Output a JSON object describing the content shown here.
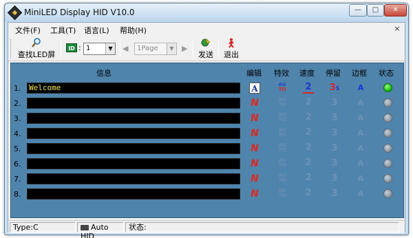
{
  "window": {
    "title": "MiniLED Display HID V10.0"
  },
  "window_controls": {
    "minimize": "—",
    "maximize": "□",
    "close": "✕"
  },
  "menu": {
    "items": [
      "文件(F)",
      "工具(T)",
      "语言(L)",
      "帮助(H)"
    ],
    "close_glyph": "×"
  },
  "toolbar": {
    "find_screen_label": "查找LED屏",
    "id_label": "ID",
    "id_colon": ":",
    "id_value": "1",
    "prev_glyph": "◀",
    "page_value": "1Page",
    "next_glyph": "▶",
    "send_label": "发送",
    "exit_label": "退出"
  },
  "table": {
    "headers": {
      "info": "信息",
      "edit": "编辑",
      "effect": "特效",
      "speed": "速度",
      "stay": "停留",
      "border": "边框",
      "status": "状态"
    },
    "rows": [
      {
        "num": "1.",
        "text": "Welcome",
        "active": true
      },
      {
        "num": "2.",
        "text": "",
        "active": false
      },
      {
        "num": "3.",
        "text": "",
        "active": false
      },
      {
        "num": "4.",
        "text": "",
        "active": false
      },
      {
        "num": "5.",
        "text": "",
        "active": false
      },
      {
        "num": "6.",
        "text": "",
        "active": false
      },
      {
        "num": "7.",
        "text": "",
        "active": false
      },
      {
        "num": "8.",
        "text": "",
        "active": false
      }
    ],
    "icon_glyphs": {
      "edit_active": "A",
      "edit_inactive": "N",
      "effect_top": "AU",
      "effect_bottom": "TO",
      "speed": "2",
      "stay": "3",
      "stay_suffix": "S",
      "border": "A"
    }
  },
  "statusbar": {
    "type": "Type:C",
    "mode": "Auto HID",
    "status_label": "状态:"
  },
  "colors": {
    "panel_bg": "#4f84ad",
    "lcd_text": "#f2e833",
    "status_on": "#19c010",
    "status_off": "#8f9ba6"
  }
}
